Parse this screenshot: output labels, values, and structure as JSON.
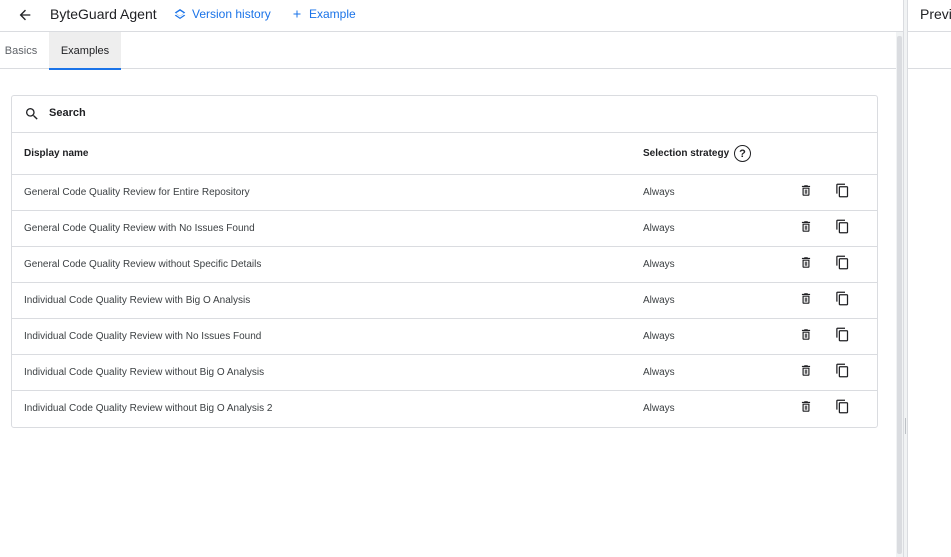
{
  "header": {
    "title": "ByteGuard Agent",
    "version_history_label": "Version history",
    "add_example_label": "Example"
  },
  "tabs": [
    {
      "label": "Basics",
      "active": false
    },
    {
      "label": "Examples",
      "active": true
    }
  ],
  "search": {
    "label": "Search"
  },
  "table": {
    "columns": {
      "display_name": "Display name",
      "selection_strategy": "Selection strategy"
    },
    "rows": [
      {
        "name": "General Code Quality Review for Entire Repository",
        "strategy": "Always"
      },
      {
        "name": "General Code Quality Review with No Issues Found",
        "strategy": "Always"
      },
      {
        "name": "General Code Quality Review without Specific Details",
        "strategy": "Always"
      },
      {
        "name": "Individual Code Quality Review with Big O Analysis",
        "strategy": "Always"
      },
      {
        "name": "Individual Code Quality Review with No Issues Found",
        "strategy": "Always"
      },
      {
        "name": "Individual Code Quality Review without Big O Analysis",
        "strategy": "Always"
      },
      {
        "name": "Individual Code Quality Review without Big O Analysis 2",
        "strategy": "Always"
      }
    ]
  },
  "preview": {
    "title": "Preview"
  },
  "colors": {
    "accent": "#1a73e8",
    "border": "#dadce0",
    "text": "#202124"
  },
  "icons": [
    "back-arrow-icon",
    "layers-icon",
    "plus-icon",
    "search-icon",
    "help-icon",
    "trash-icon",
    "copy-icon"
  ]
}
